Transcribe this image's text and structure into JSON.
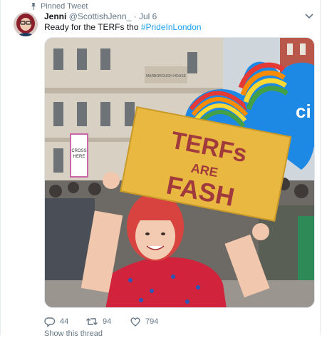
{
  "pinned_label": "Pinned Tweet",
  "tweet": {
    "display_name": "Jenni",
    "handle": "@ScottishJenn_",
    "separator": "·",
    "date": "Jul 6",
    "text": "Ready for the TERFs tho ",
    "hashtag": "#PrideInLondon",
    "actions": {
      "replies": "44",
      "retweets": "94",
      "likes": "794"
    }
  },
  "photo": {
    "sign_lines": [
      "TERFs",
      "ARE",
      "FASH"
    ],
    "building_sign": "MARBOROUGH HOUSE",
    "balloon_text": "ci",
    "small_placard": [
      "CROSS",
      "HERE"
    ]
  },
  "footer_text": "Show this thread",
  "colors": {
    "accent": "#1da1f2",
    "muted": "#657786",
    "sign": "#e8b840",
    "sign_text": "#a03a3c",
    "balloon": "#1e88e5"
  }
}
